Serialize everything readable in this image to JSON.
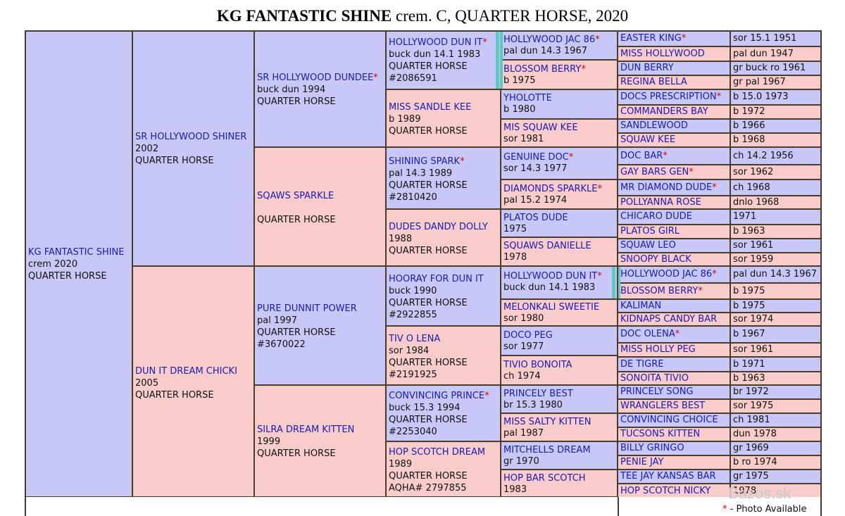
{
  "title": {
    "name": "KG FANTASTIC SHINE",
    "rest": " crem. C, QUARTER HORSE, 2020"
  },
  "gen1": {
    "name": "KG FANTASTIC SHINE",
    "l2": "crem 2020",
    "l3": "QUARTER HORSE"
  },
  "gen2": [
    {
      "name": "SR HOLLYWOOD SHINER",
      "l2": "2002",
      "l3": "QUARTER HORSE"
    },
    {
      "name": "DUN IT DREAM CHICKI",
      "l2": "2005",
      "l3": "QUARTER HORSE"
    }
  ],
  "gen3": [
    {
      "name": "SR HOLLYWOOD DUNDEE",
      "star": "*",
      "l2": "buck dun 1994",
      "l3": "QUARTER HORSE",
      "l4": ""
    },
    {
      "name": "SQAWS SPARKLE",
      "star": "",
      "l2": "",
      "l3": "QUARTER HORSE",
      "l4": ""
    },
    {
      "name": "PURE DUNNIT POWER",
      "star": "",
      "l2": "pal 1997",
      "l3": "QUARTER HORSE",
      "l4": "#3670022"
    },
    {
      "name": "SILRA DREAM KITTEN",
      "star": "",
      "l2": "1999",
      "l3": "QUARTER HORSE",
      "l4": ""
    }
  ],
  "gen4": [
    {
      "name": "HOLLYWOOD DUN IT",
      "star": "*",
      "l2": "buck dun 14.1 1983",
      "l3": "QUARTER HORSE",
      "l4": "#2086591"
    },
    {
      "name": "MISS SANDLE KEE",
      "star": "",
      "l2": "b 1989",
      "l3": "QUARTER HORSE",
      "l4": ""
    },
    {
      "name": "SHINING SPARK",
      "star": "*",
      "l2": "pal 14.3 1989",
      "l3": "QUARTER HORSE",
      "l4": "#2810420"
    },
    {
      "name": "DUDES DANDY DOLLY",
      "star": "",
      "l2": "1988",
      "l3": "QUARTER HORSE",
      "l4": ""
    },
    {
      "name": "HOORAY FOR DUN IT",
      "star": "",
      "l2": "buck 1990",
      "l3": "QUARTER HORSE",
      "l4": "#2922855"
    },
    {
      "name": "TIV O LENA",
      "star": "",
      "l2": "sor 1984",
      "l3": "QUARTER HORSE",
      "l4": "#2191925"
    },
    {
      "name": "CONVINCING PRINCE",
      "star": "*",
      "l2": "buck 15.3 1994",
      "l3": "QUARTER HORSE",
      "l4": "#2253040"
    },
    {
      "name": "HOP SCOTCH DREAM",
      "star": "",
      "l2": "1989",
      "l3": "QUARTER HORSE",
      "l4": "AQHA# 2797855"
    }
  ],
  "gen5": [
    {
      "name": "HOLLYWOOD JAC 86",
      "star": "*",
      "l2": "pal dun 14.3 1967"
    },
    {
      "name": "BLOSSOM BERRY",
      "star": "*",
      "l2": "b 1975"
    },
    {
      "name": "YHOLOTTE",
      "star": "",
      "l2": "b 1980"
    },
    {
      "name": "MIS SQUAW KEE",
      "star": "",
      "l2": "sor 1981"
    },
    {
      "name": "GENUINE DOC",
      "star": "*",
      "l2": "sor 14.3 1977"
    },
    {
      "name": "DIAMONDS SPARKLE",
      "star": "*",
      "l2": "pal 15.2 1974"
    },
    {
      "name": "PLATOS DUDE",
      "star": "",
      "l2": "1975"
    },
    {
      "name": "SQUAWS DANIELLE",
      "star": "",
      "l2": "1978"
    },
    {
      "name": "HOLLYWOOD DUN IT",
      "star": "*",
      "l2": "buck dun 14.1 1983"
    },
    {
      "name": "MELONKALI SWEETIE",
      "star": "",
      "l2": "sor 1980"
    },
    {
      "name": "DOCO PEG",
      "star": "",
      "l2": "sor 1977"
    },
    {
      "name": "TIVIO BONOITA",
      "star": "",
      "l2": "ch 1974"
    },
    {
      "name": "PRINCELY BEST",
      "star": "",
      "l2": "br 15.3 1980"
    },
    {
      "name": "MISS SALTY KITTEN",
      "star": "",
      "l2": "pal 1987"
    },
    {
      "name": "MITCHELLS DREAM",
      "star": "",
      "l2": "gr 1970"
    },
    {
      "name": "HOP BAR SCOTCH",
      "star": "",
      "l2": "1983"
    }
  ],
  "gen6": [
    {
      "name": "EASTER KING",
      "star": "*",
      "info": "sor 15.1 1951"
    },
    {
      "name": "MISS HOLLYWOOD",
      "star": "",
      "info": "pal dun 1947"
    },
    {
      "name": "DUN BERRY",
      "star": "",
      "info": "gr buck ro 1961"
    },
    {
      "name": "REGINA BELLA",
      "star": "",
      "info": "gr pal 1967"
    },
    {
      "name": "DOCS PRESCRIPTION",
      "star": "*",
      "info": "b 15.0 1973"
    },
    {
      "name": "COMMANDERS BAY",
      "star": "",
      "info": "b 1972"
    },
    {
      "name": "SANDLEWOOD",
      "star": "",
      "info": "b 1966"
    },
    {
      "name": "SQUAW KEE",
      "star": "",
      "info": "b 1968"
    },
    {
      "name": "DOC BAR",
      "star": "*",
      "info": "ch 14.2 1956"
    },
    {
      "name": "GAY BARS GEN",
      "star": "*",
      "info": "sor 1962"
    },
    {
      "name": "MR DIAMOND DUDE",
      "star": "*",
      "info": "ch 1968"
    },
    {
      "name": "POLLYANNA ROSE",
      "star": "",
      "info": "dnlo 1968"
    },
    {
      "name": "CHICARO DUDE",
      "star": "",
      "info": "1971"
    },
    {
      "name": "PLATOS GIRL",
      "star": "",
      "info": "b 1963"
    },
    {
      "name": "SQUAW LEO",
      "star": "",
      "info": "sor 1961"
    },
    {
      "name": "SNOOPY BLACK",
      "star": "",
      "info": "sor 1959"
    },
    {
      "name": "HOLLYWOOD JAC 86",
      "star": "*",
      "info": "pal dun 14.3 1967"
    },
    {
      "name": "BLOSSOM BERRY",
      "star": "*",
      "info": "b 1975"
    },
    {
      "name": "KALIMAN",
      "star": "",
      "info": "b 1975"
    },
    {
      "name": "KIDNAPS CANDY BAR",
      "star": "",
      "info": "sor 1974"
    },
    {
      "name": "DOC OLENA",
      "star": "*",
      "info": "b 1967"
    },
    {
      "name": "MISS HOLLY PEG",
      "star": "",
      "info": "sor 1961"
    },
    {
      "name": "DE TIGRE",
      "star": "",
      "info": "b 1971"
    },
    {
      "name": "SONOITA TIVIO",
      "star": "",
      "info": "b 1963"
    },
    {
      "name": "PRINCELY SONG",
      "star": "",
      "info": "br 1972"
    },
    {
      "name": "WRANGLERS BEST",
      "star": "",
      "info": "sor 1975"
    },
    {
      "name": "CONVINCING CHOICE",
      "star": "",
      "info": "ch 1981"
    },
    {
      "name": "TUCSONS KITTEN",
      "star": "",
      "info": "dun 1978"
    },
    {
      "name": "BILLY GRINGO",
      "star": "",
      "info": "gr 1969"
    },
    {
      "name": "PENIE JAY",
      "star": "",
      "info": "b ro 1974"
    },
    {
      "name": "TEE JAY KANSAS BAR",
      "star": "",
      "info": "gr 1975"
    },
    {
      "name": "HOP SCOTCH NICKY",
      "star": "",
      "info": "1978"
    }
  ],
  "footer": {
    "star": "*",
    "text": " - Photo Available"
  },
  "watermark": "Bazos.sk"
}
